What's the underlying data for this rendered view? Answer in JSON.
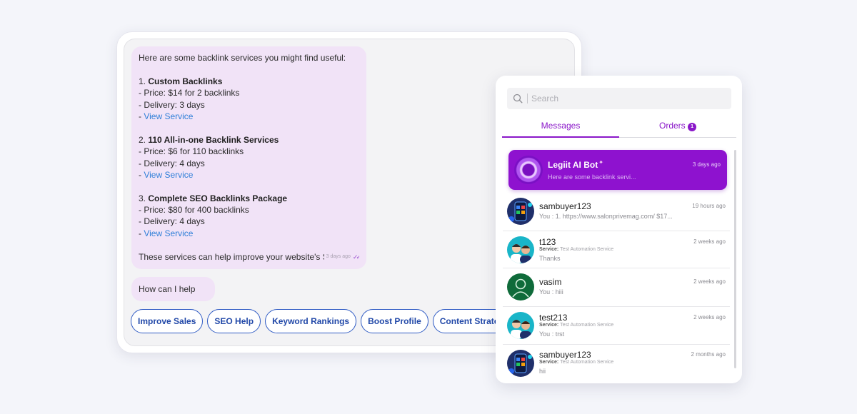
{
  "chat": {
    "intro": "Here are some backlink services you might find useful:",
    "services": [
      {
        "title": "Custom Backlinks",
        "price": "- Price: $14 for 2 backlinks",
        "delivery": "- Delivery: 3 days",
        "link": "View Service"
      },
      {
        "title": "110 All-in-one Backlink Services",
        "price": "- Price: $6 for 110 backlinks",
        "delivery": "- Delivery: 4 days",
        "link": "View Service"
      },
      {
        "title": "Complete SEO Backlinks Package",
        "price": "- Price: $80 for 400 backlinks",
        "delivery": "- Delivery: 4 days",
        "link": "View Service"
      }
    ],
    "closing": "These services can help improve your website's SEO!",
    "closing_time": "3 days ago",
    "help_message": "How can I help you?",
    "suggestions": [
      "Improve Sales",
      "SEO Help",
      "Keyword Rankings",
      "Boost Profile",
      "Content Strategies"
    ]
  },
  "inbox": {
    "search_placeholder": "Search",
    "tabs": {
      "messages": "Messages",
      "orders": "Orders",
      "orders_badge": "1"
    },
    "bot": {
      "name": "Legiit AI Bot",
      "time": "3 days ago",
      "preview": "Here are some backlink servi..."
    },
    "conversations": [
      {
        "name": "sambuyer123",
        "time": "19 hours ago",
        "service_label": "",
        "service": "",
        "preview": "You : 1. https://www.salonprivemag.com/ $17..."
      },
      {
        "name": "t123",
        "time": "2 weeks ago",
        "service_label": "Service:",
        "service": "Test Automation Service",
        "preview": "Thanks"
      },
      {
        "name": "vasim",
        "time": "2 weeks ago",
        "service_label": "",
        "service": "",
        "preview": "You : hiii"
      },
      {
        "name": "test213",
        "time": "2 weeks ago",
        "service_label": "Service:",
        "service": "Test Automation Service",
        "preview": "You : trst"
      },
      {
        "name": "sambuyer123",
        "time": "2 months ago",
        "service_label": "Service:",
        "service": "Test Automation Service",
        "preview": "hii"
      }
    ]
  },
  "colors": {
    "accent": "#8a17c9",
    "link": "#2f7fd8",
    "chip_border": "#2f5bc4",
    "bubble": "#f1e3f7"
  }
}
